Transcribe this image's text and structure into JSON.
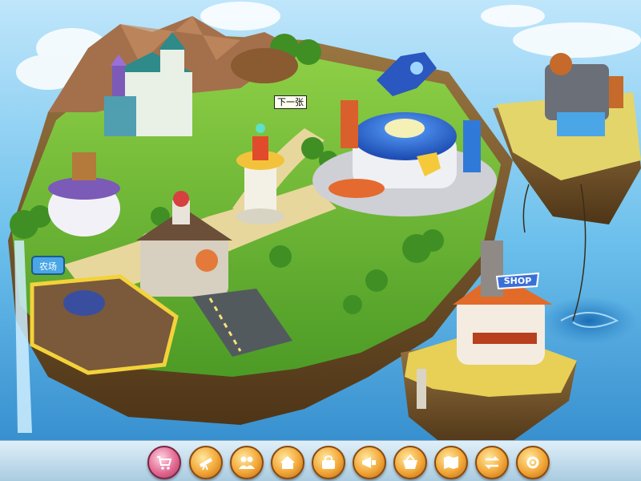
{
  "tooltip": {
    "text": "下一张"
  },
  "signs": {
    "shop": "SHOP",
    "farm": "农场"
  },
  "toolbar": {
    "buttons": [
      {
        "name": "cart-icon",
        "active": true
      },
      {
        "name": "telescope-icon",
        "active": false
      },
      {
        "name": "friends-icon",
        "active": false
      },
      {
        "name": "home-icon",
        "active": false
      },
      {
        "name": "bag-icon",
        "active": false
      },
      {
        "name": "megaphone-icon",
        "active": false
      },
      {
        "name": "basket-icon",
        "active": false
      },
      {
        "name": "map-icon",
        "active": false
      },
      {
        "name": "exchange-icon",
        "active": false
      },
      {
        "name": "settings-icon",
        "active": false
      }
    ]
  },
  "colors": {
    "sky": "#5fb6e6",
    "grass": "#6fbf3a",
    "cliff": "#8b6a3a",
    "toolbar_btn": "#f2a636",
    "active_btn": "#e26a93"
  }
}
